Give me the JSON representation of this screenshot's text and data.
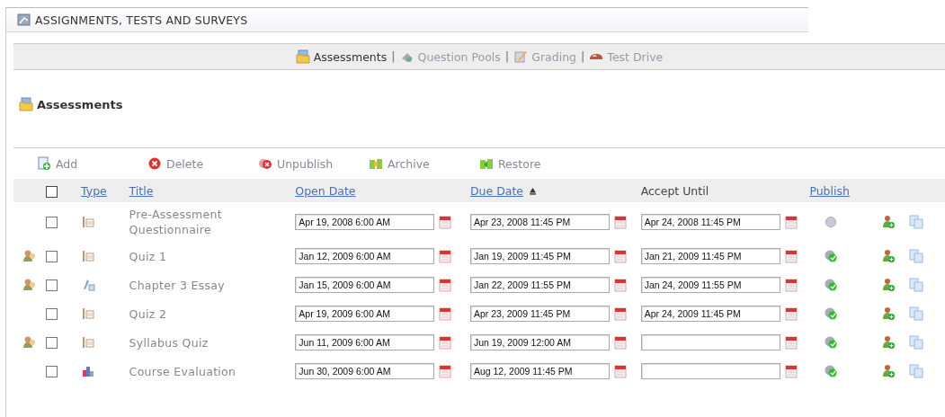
{
  "header": {
    "title": "ASSIGNMENTS, TESTS AND SURVEYS"
  },
  "nav": [
    {
      "label": "Assessments",
      "selected": true
    },
    {
      "separator": "|",
      "label": "Question Pools",
      "selected": false
    },
    {
      "separator": "|",
      "label": "Grading",
      "selected": false
    },
    {
      "separator": "|",
      "label": "Test Drive",
      "selected": false
    }
  ],
  "section": {
    "title": "Assessments"
  },
  "toolbar": [
    {
      "label": "Add"
    },
    {
      "label": "Delete"
    },
    {
      "label": "Unpublish"
    },
    {
      "label": "Archive"
    },
    {
      "label": "Restore"
    }
  ],
  "table": {
    "select_all": {
      "checked": false
    },
    "columns": [
      {
        "label": "Type",
        "kind": "link"
      },
      {
        "label": "Title",
        "kind": "link"
      },
      {
        "label": "Open Date",
        "kind": "link"
      },
      {
        "label": "Due Date",
        "kind": "link",
        "sorted": true
      },
      {
        "label": "Accept Until",
        "kind": "plain"
      },
      {
        "label": "Publish",
        "kind": "link"
      }
    ],
    "rows": [
      {
        "assigned": false,
        "checked": false,
        "kind": "quiz",
        "title": "Pre-Assessment Questionnaire",
        "open_date": "Apr 19, 2008 6:00 AM",
        "due_date": "Apr 23, 2008 11:45 PM",
        "accept_until": "Apr 24, 2008 11:45 PM",
        "published": false
      },
      {
        "assigned": true,
        "checked": false,
        "kind": "quiz",
        "title": "Quiz 1",
        "open_date": "Jan 12, 2009 6:00 AM",
        "due_date": "Jan 19, 2009 11:45 PM",
        "accept_until": "Jan 21, 2009 11:45 PM",
        "published": true
      },
      {
        "assigned": true,
        "checked": false,
        "kind": "essay",
        "title": "Chapter 3 Essay",
        "open_date": "Jan 15, 2009 6:00 AM",
        "due_date": "Jan 22, 2009 11:55 PM",
        "accept_until": "Jan 24, 2009 11:55 PM",
        "published": true
      },
      {
        "assigned": false,
        "checked": false,
        "kind": "quiz",
        "title": "Quiz 2",
        "open_date": "Apr 19, 2009 6:00 AM",
        "due_date": "Apr 23, 2009 11:45 PM",
        "accept_until": "Apr 24, 2009 11:45 PM",
        "published": true
      },
      {
        "assigned": true,
        "checked": false,
        "kind": "quiz",
        "title": "Syllabus Quiz",
        "open_date": "Jun 11, 2009 6:00 AM",
        "due_date": "Jun 19, 2009 12:00 AM",
        "published": true
      },
      {
        "assigned": false,
        "checked": false,
        "kind": "survey",
        "title": "Course Evaluation",
        "open_date": "Jun 30, 2009 6:00 AM",
        "due_date": "Aug 12, 2009 11:45 PM",
        "published": true
      }
    ]
  }
}
